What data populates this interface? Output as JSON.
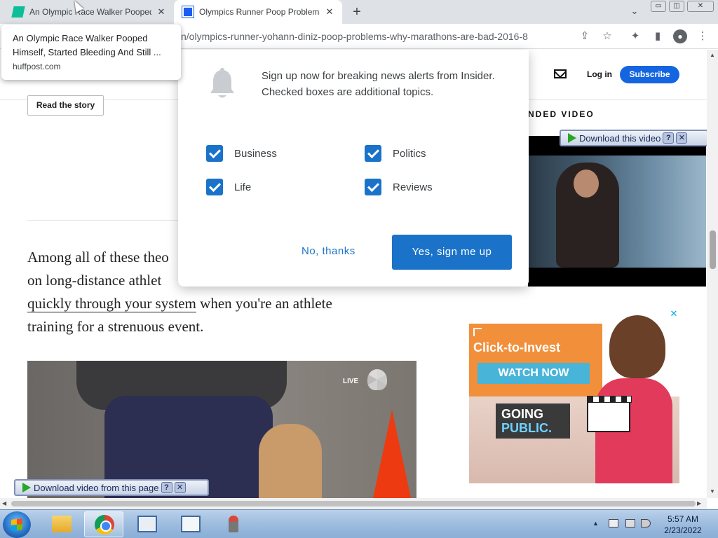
{
  "browser": {
    "tabs": [
      {
        "title": "An Olympic Race Walker Pooped Himself, Started Bleeding And Still ...",
        "close": "✕"
      },
      {
        "title": "Olympics Runner Poop Problems Why Marathons Are Bad - Insider",
        "close": "✕"
      }
    ],
    "newtab": "+",
    "tabsearch": "⌄",
    "window_controls": {
      "min": "▭",
      "max": "◫",
      "close": "✕"
    },
    "url": "n/olympics-runner-yohann-diniz-poop-problems-why-marathons-are-bad-2016-8",
    "toolbar_icons": {
      "share": "⇪",
      "star": "☆",
      "extensions": "✦",
      "panel": "▮",
      "profile": "●",
      "menu": "⋮"
    }
  },
  "hovercard": {
    "title": "An Olympic Race Walker Pooped Himself, Started Bleeding And Still ...",
    "domain": "huffpost.com"
  },
  "site": {
    "login": "Log in",
    "subscribe": "Subscribe",
    "read_story": "Read the story",
    "recommended_video_label": "NDED VIDEO"
  },
  "article": {
    "p1_line1": "Among all of these theo",
    "p1_line2": "on long-distance athlet",
    "p1_link_partial": "",
    "p1_line3_link": "quickly through your system",
    "p1_line3_rest": " when you're an athlete",
    "p1_line4": "training for a strenuous event.",
    "image_live_label": "LIVE"
  },
  "popover": {
    "message": "Sign up now for breaking news alerts from Insider. Checked boxes are additional topics.",
    "topics": [
      {
        "label": "Business",
        "checked": true
      },
      {
        "label": "Politics",
        "checked": true
      },
      {
        "label": "Life",
        "checked": true
      },
      {
        "label": "Reviews",
        "checked": true
      }
    ],
    "decline": "No, thanks",
    "accept": "Yes, sign me up"
  },
  "ad": {
    "headline": "Click-to-Invest",
    "cta": "WATCH NOW",
    "going": "GOING",
    "public": "PUBLIC.",
    "close": "✕"
  },
  "download_bars": {
    "top": {
      "label": "Download this video",
      "help": "?",
      "close": "✕"
    },
    "bottom": {
      "label": "Download video from this page",
      "help": "?",
      "close": "✕"
    }
  },
  "scrollbars": {
    "up": "▲",
    "down": "▼",
    "left": "◀",
    "right": "▶"
  },
  "taskbar": {
    "tray_up": "▲",
    "time": "5:57 AM",
    "date": "2/23/2022"
  },
  "colors": {
    "insider_blue": "#1466e0",
    "dialog_blue": "#1a73c9",
    "ad_orange": "#f28f3b"
  }
}
